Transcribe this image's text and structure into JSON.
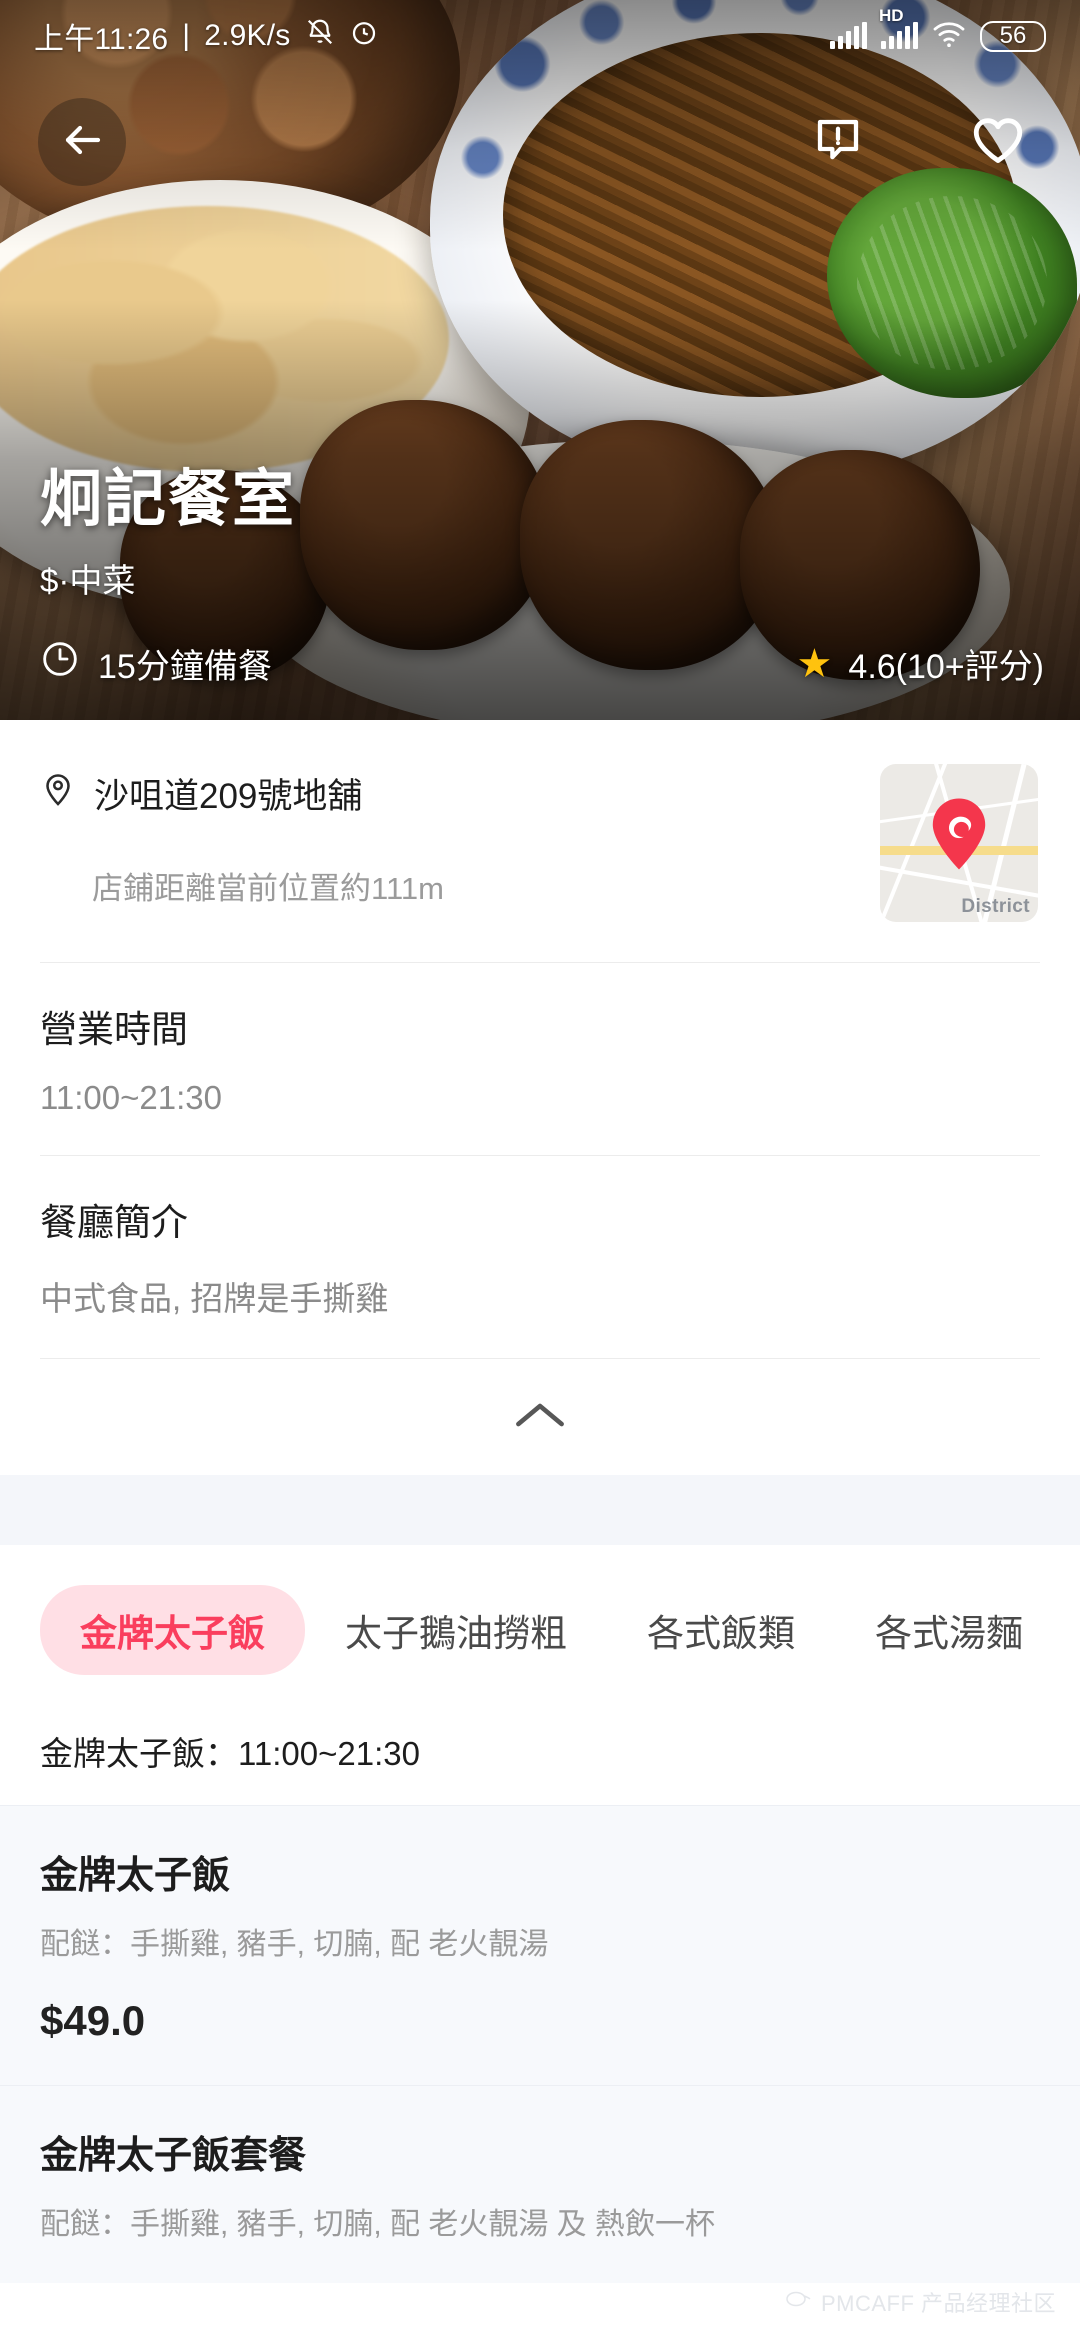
{
  "status_bar": {
    "time": "上午11:26",
    "separator": "|",
    "net_speed": "2.9K/s",
    "mute_icon": "mute-bell-icon",
    "alarm_icon": "alarm-clock-icon",
    "signal_icon": "signal-bars-icon",
    "hd_label": "HD",
    "signal2_icon": "signal-bars-icon",
    "wifi_icon": "wifi-icon",
    "battery": "56"
  },
  "hero": {
    "back_icon": "back-arrow-icon",
    "report_icon": "report-complaint-icon",
    "favorite_icon": "heart-outline-icon",
    "restaurant_name": "炯記餐室",
    "price_category": "$·中菜",
    "clock_icon": "clock-icon",
    "prep_time": "15分鐘備餐",
    "star_icon": "star-icon",
    "rating": "4.6(10+評分)"
  },
  "info": {
    "pin_icon": "location-pin-icon",
    "address": "沙咀道209號地舖",
    "distance": "店鋪距離當前位置約111m",
    "map": {
      "pin_icon": "map-marker-logo-icon",
      "label": "District"
    },
    "hours_title": "營業時間",
    "hours_value": "11:00~21:30",
    "intro_title": "餐廳簡介",
    "intro_value": "中式食品, 招牌是手撕雞",
    "collapse_icon": "chevron-up-icon"
  },
  "menu": {
    "tabs": [
      {
        "label": "金牌太子飯",
        "active": true
      },
      {
        "label": "太子鵝油撈粗",
        "active": false
      },
      {
        "label": "各式飯類",
        "active": false
      },
      {
        "label": "各式湯麵",
        "active": false
      }
    ],
    "category_hours": "金牌太子飯：11:00~21:30",
    "items": [
      {
        "name": "金牌太子飯",
        "desc": "配餸：手撕雞, 豬手, 切腩, 配 老火靚湯",
        "price": "$49.0"
      },
      {
        "name": "金牌太子飯套餐",
        "desc": "配餸：手撕雞, 豬手, 切腩, 配 老火靚湯 及 熱飲一杯",
        "price": ""
      }
    ]
  },
  "watermark": {
    "icon": "pmcaff-logo-icon",
    "text": "PMCAFF 产品经理社区"
  },
  "colors": {
    "accent_pink": "#fa3e5d",
    "accent_pink_bg": "#ffdfe5",
    "star_gold": "#ffc20e",
    "section_gap": "#f4f6fa",
    "item_bg": "#f7f9fc"
  }
}
